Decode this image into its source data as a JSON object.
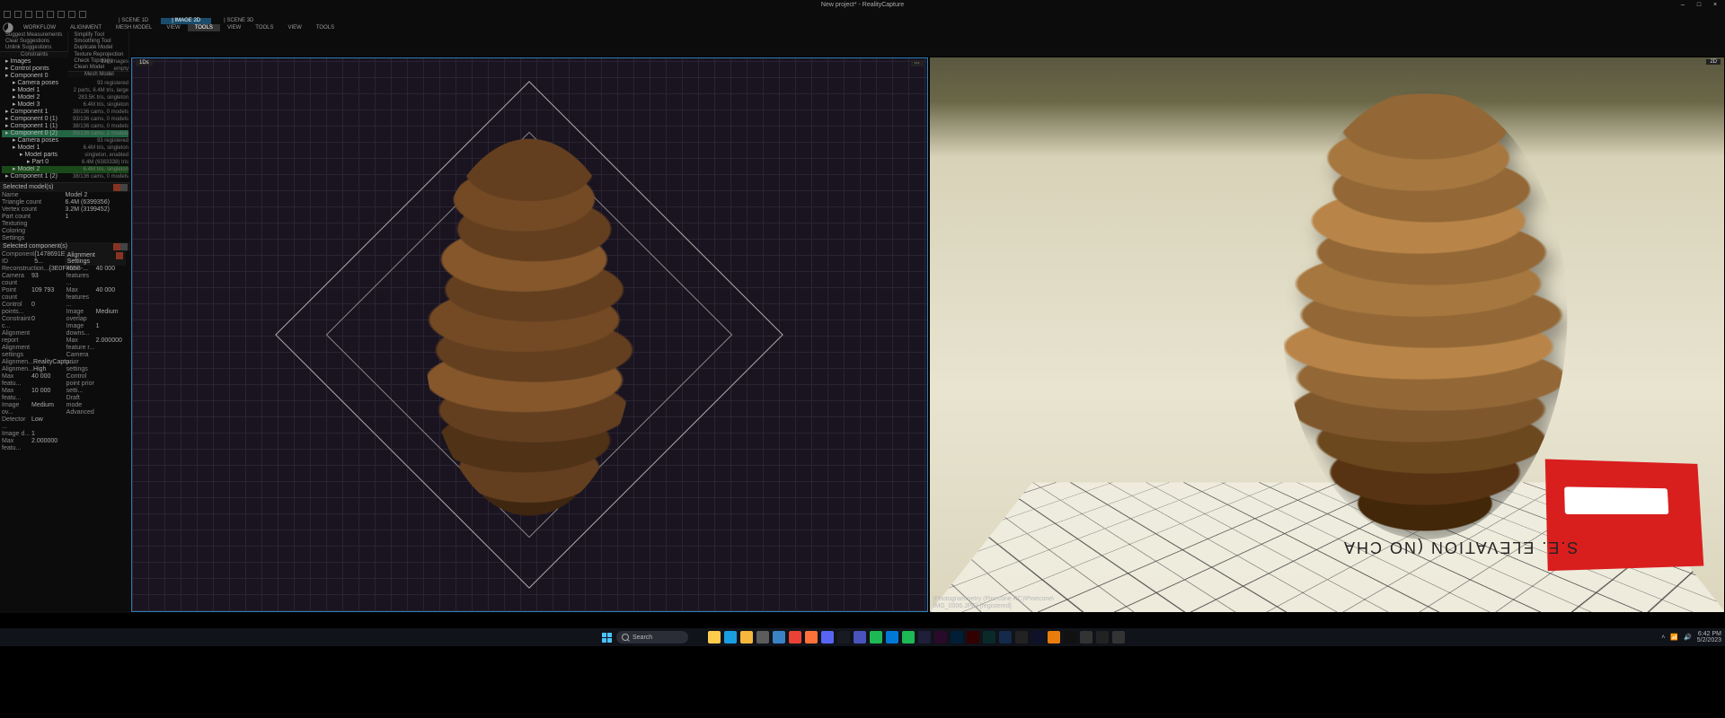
{
  "title": "New project* - RealityCapture",
  "window_controls": {
    "min": "–",
    "max": "□",
    "close": "×"
  },
  "layer_tabs": [
    "SCENE 1D",
    "IMAGE 2D",
    "SCENE 3D"
  ],
  "layer_active_index": 1,
  "ribbon_tabs": [
    "WORKFLOW",
    "ALIGNMENT",
    "MESH MODEL",
    "VIEW",
    "TOOLS",
    "VIEW",
    "TOOLS",
    "VIEW",
    "TOOLS"
  ],
  "ribbon_active_index": 4,
  "ribbon_groups": [
    {
      "label": "Constraints",
      "items": [
        "Suggest Measurements",
        "Clear Suggestions",
        "Unlink Suggestions"
      ]
    },
    {
      "label": "Mesh Model",
      "items": [
        "Simplify Tool",
        "Smoothing Tool",
        "Duplicate Model",
        "Texture Reprojection",
        "Check Topology",
        "Clean Model"
      ]
    }
  ],
  "tree": [
    {
      "ind": 0,
      "l": "Images",
      "r": "136 images"
    },
    {
      "ind": 0,
      "l": "Control points",
      "r": "empty"
    },
    {
      "ind": 0,
      "l": "Component 0",
      "r": "93/136 cams, 3 models"
    },
    {
      "ind": 1,
      "l": "Camera poses",
      "r": "93 registered"
    },
    {
      "ind": 1,
      "l": "Model 1",
      "r": "2 parts, 6.4M tris, large"
    },
    {
      "ind": 1,
      "l": "Model 2",
      "r": "283.5K tris, singleton"
    },
    {
      "ind": 1,
      "l": "Model 3",
      "r": "6.4M tris, singleton"
    },
    {
      "ind": 0,
      "l": "Component 1",
      "r": "38/136 cams, 0 models"
    },
    {
      "ind": 0,
      "l": "Component 0 (1)",
      "r": "93/136 cams, 0 models"
    },
    {
      "ind": 0,
      "l": "Component 1 (1)",
      "r": "38/136 cams, 0 models"
    },
    {
      "ind": 0,
      "l": "Component 0 (2)",
      "r": "93/136 cams, 2 models",
      "sel": true
    },
    {
      "ind": 1,
      "l": "Camera poses",
      "r": "93 registered"
    },
    {
      "ind": 1,
      "l": "Model 1",
      "r": "6.4M tris, singleton"
    },
    {
      "ind": 2,
      "l": "Model parts",
      "r": "singleton, enabled"
    },
    {
      "ind": 3,
      "l": "Part 0",
      "r": "6.4M (6383338) tris"
    },
    {
      "ind": 1,
      "l": "Model 2",
      "r": "6.4M tris, singleton",
      "hl": true
    },
    {
      "ind": 0,
      "l": "Component 1 (2)",
      "r": "38/136 cams, 0 models"
    }
  ],
  "props_left": {
    "title": "Selected model(s)",
    "rows": [
      {
        "k": "Name",
        "v": "Model 2"
      },
      {
        "k": "Triangle count",
        "v": "6.4M (6399356)"
      },
      {
        "k": "Vertex count",
        "v": "3.2M (3199452)"
      },
      {
        "k": "Part count",
        "v": "1"
      },
      {
        "k": "Texturing",
        "v": ""
      },
      {
        "k": "Coloring",
        "v": ""
      },
      {
        "k": "Settings",
        "v": ""
      }
    ],
    "title2": "Selected component(s)",
    "rows2": [
      {
        "k": "Component ID",
        "v": "{1478691E-5..."
      },
      {
        "k": "Reconstruction...",
        "v": "{3E0F455B-..."
      },
      {
        "k": "Camera count",
        "v": "93"
      },
      {
        "k": "Point count",
        "v": "109 793"
      },
      {
        "k": "Control points...",
        "v": "0"
      },
      {
        "k": "Constraint c...",
        "v": "0"
      },
      {
        "k": "Alignment report",
        "v": ""
      },
      {
        "k": "Alignment settings",
        "v": ""
      },
      {
        "k": "Alignmen...",
        "v": "RealityCaptu..."
      },
      {
        "k": "Alignmen...",
        "v": "High"
      },
      {
        "k": "Max featu...",
        "v": "40 000"
      },
      {
        "k": "Max featu...",
        "v": "10 000"
      },
      {
        "k": "Image ov...",
        "v": "Medium"
      },
      {
        "k": "Detector ...",
        "v": "Low"
      },
      {
        "k": "Image d...",
        "v": "1"
      },
      {
        "k": "Max featu...",
        "v": "2.000000"
      }
    ]
  },
  "props_right": {
    "title": "Alignment Settings",
    "rows": [
      {
        "k": "Max features ...",
        "v": "40 000"
      },
      {
        "k": "Max features ...",
        "v": "40 000"
      },
      {
        "k": "Image overlap",
        "v": "Medium"
      },
      {
        "k": "Image downs...",
        "v": "1"
      },
      {
        "k": "Max feature r...",
        "v": "2.000000"
      },
      {
        "k": "Camera prior settings",
        "v": ""
      },
      {
        "k": "Control point prior setti...",
        "v": ""
      },
      {
        "k": "Draft mode",
        "v": ""
      },
      {
        "k": "Advanced",
        "v": ""
      }
    ]
  },
  "viewport_left": {
    "label": "1Ds"
  },
  "viewport_right": {
    "label": "2D",
    "status_lines": [
      "[Photogrammetry (Pinecone RC)\\Pinecone\\",
      "IMG_0006.JPG] [registered]"
    ],
    "elevation_text": "S.E. ELEVATION (NO CHA"
  },
  "taskbar": {
    "search_placeholder": "Search",
    "tray_time": "6:42 PM",
    "tray_date": "5/2/2023",
    "apps": [
      {
        "name": "start",
        "c": "transparent"
      },
      {
        "name": "explorer",
        "c": "#ffcc4d"
      },
      {
        "name": "edge",
        "c": "#1b9de2"
      },
      {
        "name": "folder",
        "c": "#f6b73c"
      },
      {
        "name": "settings",
        "c": "#5c5c5c"
      },
      {
        "name": "store",
        "c": "#3b82c4"
      },
      {
        "name": "chrome",
        "c": "#ea4335"
      },
      {
        "name": "firefox",
        "c": "#ff7139"
      },
      {
        "name": "discord",
        "c": "#5865f2"
      },
      {
        "name": "steam",
        "c": "#171a21"
      },
      {
        "name": "teams",
        "c": "#4b53bc"
      },
      {
        "name": "app1",
        "c": "#1db954"
      },
      {
        "name": "app2",
        "c": "#0078d4"
      },
      {
        "name": "spotify",
        "c": "#1db954"
      },
      {
        "name": "ae",
        "c": "#1f1f3a"
      },
      {
        "name": "pr",
        "c": "#2a0a2a"
      },
      {
        "name": "ps",
        "c": "#001e36"
      },
      {
        "name": "ai",
        "c": "#330000"
      },
      {
        "name": "dn",
        "c": "#0a2a2a"
      },
      {
        "name": "app3",
        "c": "#142a4a"
      },
      {
        "name": "unity",
        "c": "#222"
      },
      {
        "name": "ue",
        "c": "#0e1128"
      },
      {
        "name": "blender",
        "c": "#e87d0d"
      },
      {
        "name": "rc",
        "c": "#111"
      },
      {
        "name": "app4",
        "c": "#333"
      },
      {
        "name": "app5",
        "c": "#222"
      },
      {
        "name": "app6",
        "c": "#333"
      }
    ]
  }
}
